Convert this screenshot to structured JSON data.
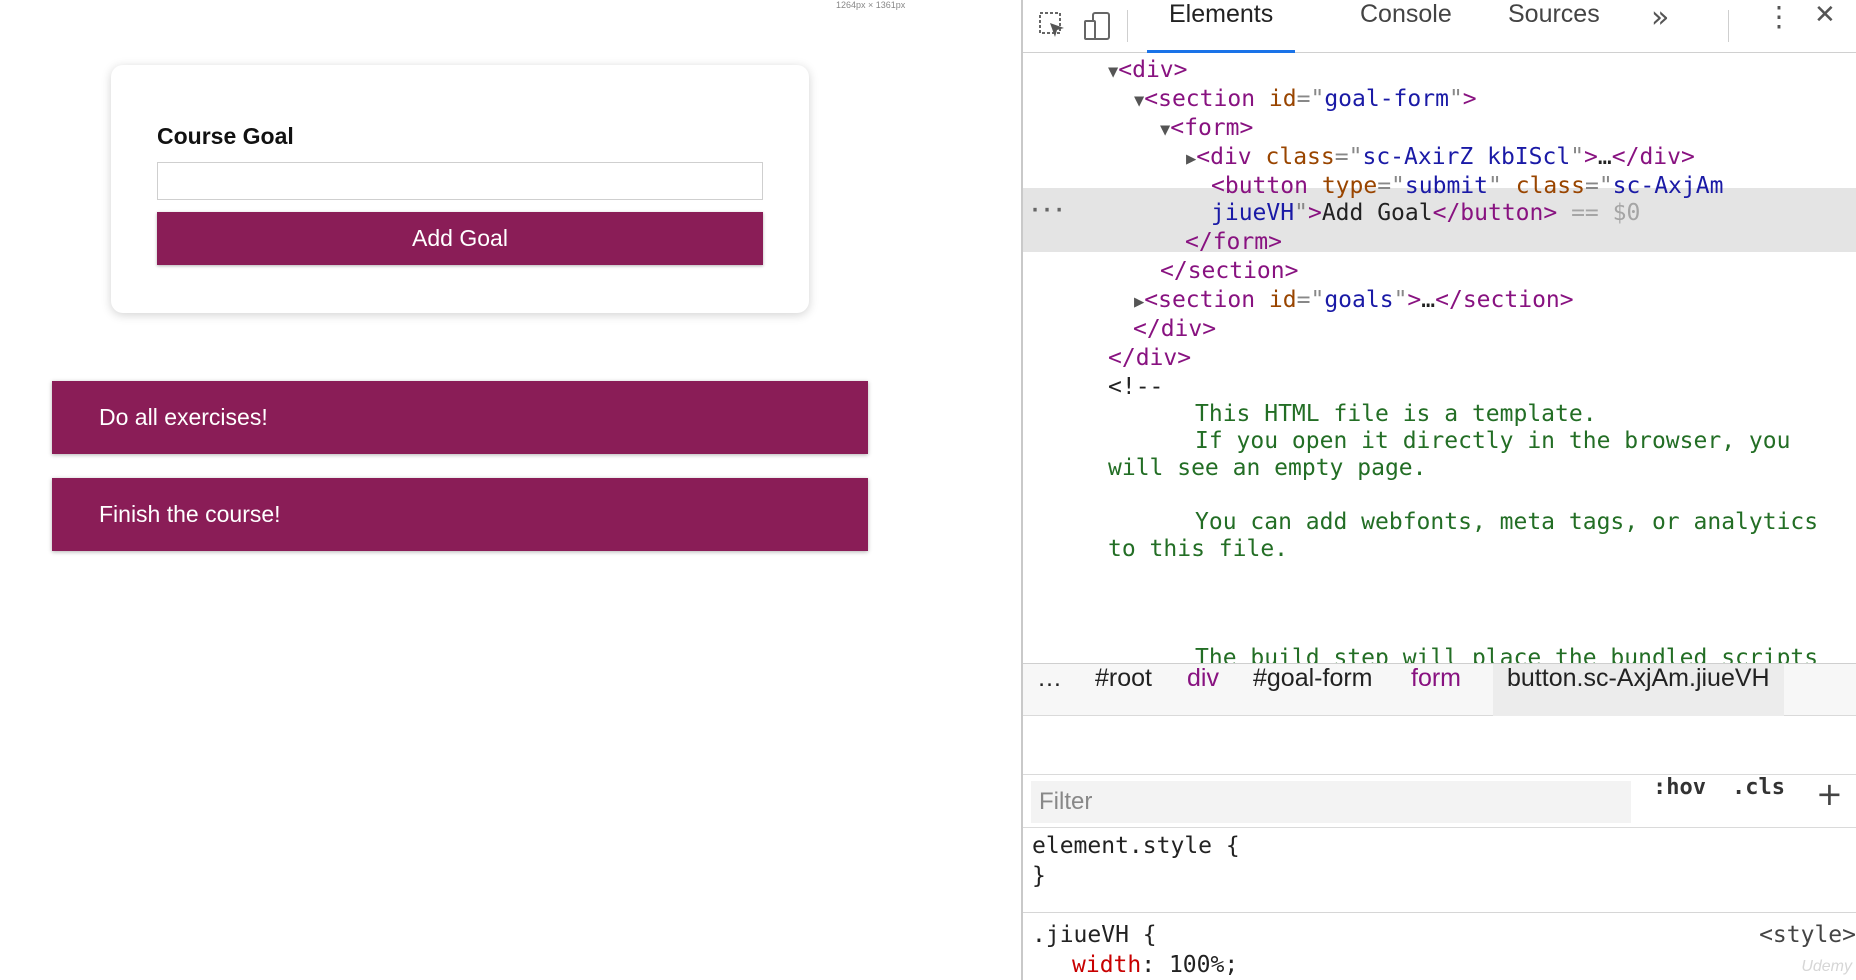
{
  "viewport": {
    "size_label": "1264px × 1361px",
    "form": {
      "label": "Course Goal",
      "input_value": "",
      "button_label": "Add Goal"
    },
    "goals": [
      "Do all exercises!",
      "Finish the course!"
    ],
    "accent_color": "#8a1d57"
  },
  "devtools": {
    "tabs": [
      "Elements",
      "Console",
      "Sources"
    ],
    "active_tab": "Elements",
    "more_tabs_glyph": "»",
    "menu_glyph": "⋮",
    "close_glyph": "✕",
    "icons": [
      "inspect-element-icon",
      "device-toolbar-icon",
      "more-tabs-icon",
      "kebab-menu-icon",
      "close-icon"
    ],
    "dom": {
      "l1_tag": "div",
      "l2_tag": "section",
      "l2_attr": "id",
      "l2_val": "goal-form",
      "l3_tag": "form",
      "l4_tag": "div",
      "l4_attr": "class",
      "l4_val": "sc-AxirZ kbIScl",
      "l4_end": "</div>",
      "sel_tag": "button",
      "sel_attr1": "type",
      "sel_val1": "submit",
      "sel_attr2": "class",
      "sel_val2a": "sc-AxjAm",
      "sel_val2b": "jiueVH",
      "sel_text": "Add Goal",
      "sel_close": "</button>",
      "sel_marker": "== $0",
      "l6_close": "</form>",
      "l7_close": "</section>",
      "l8_tag": "section",
      "l8_attr": "id",
      "l8_val": "goals",
      "l8_end": "</section>",
      "l9_close": "</div>",
      "l10_close": "</div>",
      "comment_open": "<!--",
      "comment_lines": [
        "This HTML file is a template.",
        "If you open it directly in the browser, you",
        "will see an empty page.",
        "You can add webfonts, meta tags, or analytics",
        "to this file.",
        "The build step will place the bundled scripts"
      ],
      "ellipsis": "…"
    },
    "breadcrumbs": {
      "dots": "…",
      "items": [
        "#root",
        "div",
        "#goal-form",
        "form",
        "button.sc-AxjAm.jiueVH"
      ]
    },
    "filter": {
      "placeholder": "Filter",
      "hov": ":hov",
      "cls": ".cls",
      "add": "+"
    },
    "styles": {
      "rule1_selector": "element.style {",
      "rule1_close": "}",
      "rule2_selector": ".jiueVH {",
      "rule2_source": "<style>",
      "rule2_prop": "width",
      "rule2_value": "100%;"
    },
    "watermark": "Udemy"
  }
}
